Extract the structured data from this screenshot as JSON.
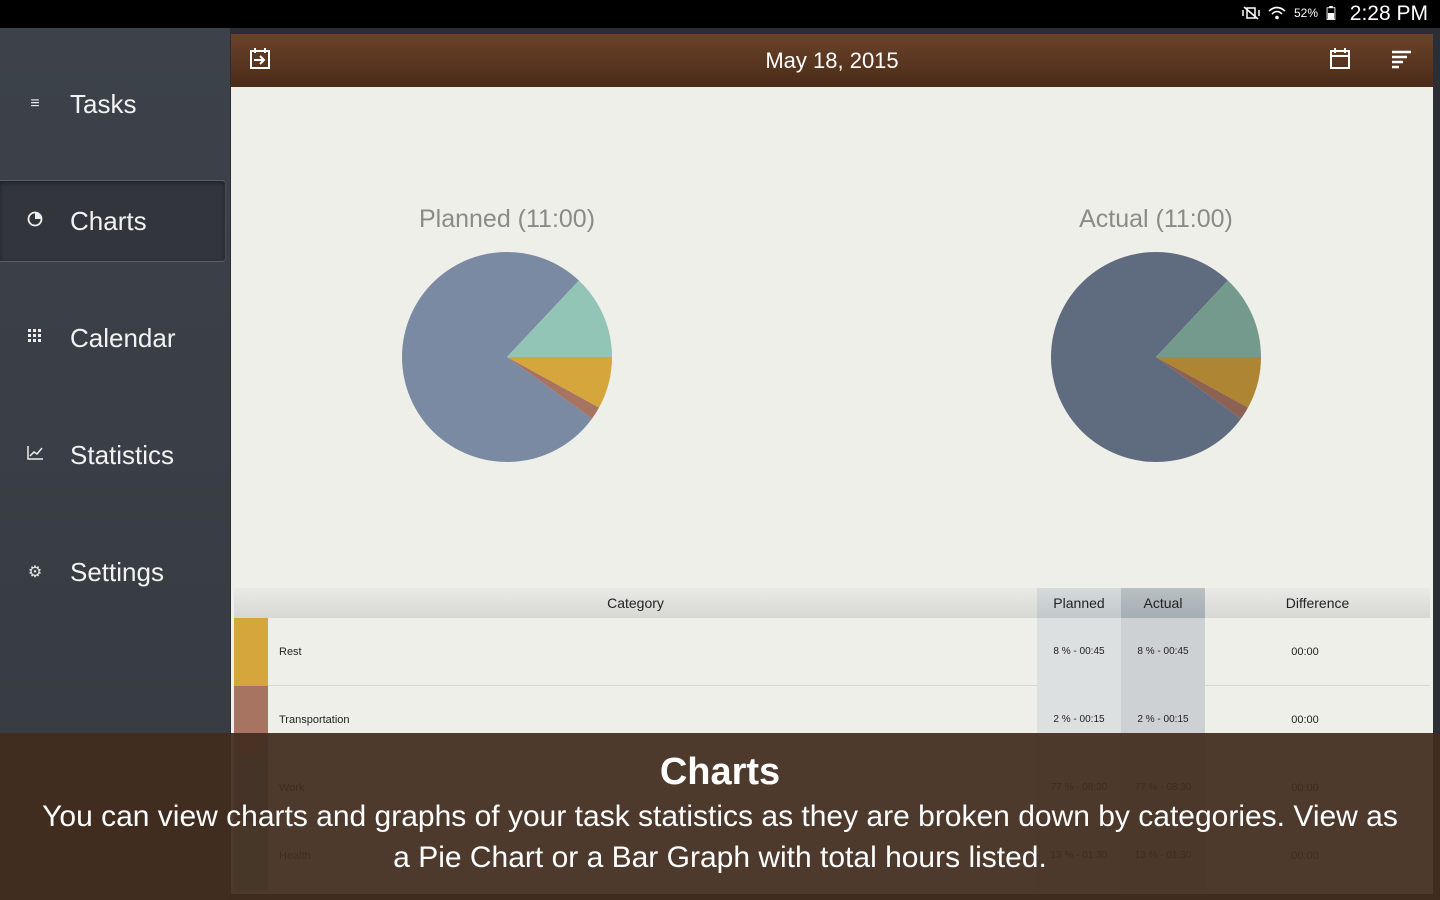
{
  "status_bar": {
    "battery": "52%",
    "clock": "2:28 PM",
    "icons": [
      "mute-vibrate-icon",
      "wifi-icon",
      "battery-icon"
    ]
  },
  "sidebar": {
    "items": [
      {
        "label": "Tasks",
        "icon": "menu-icon"
      },
      {
        "label": "Charts",
        "icon": "pie-chart-icon",
        "active": true
      },
      {
        "label": "Calendar",
        "icon": "grid-icon"
      },
      {
        "label": "Statistics",
        "icon": "line-chart-icon"
      },
      {
        "label": "Settings",
        "icon": "gear-icon"
      }
    ]
  },
  "toolbar": {
    "date": "May 18, 2015",
    "left_icon": "export-calendar-icon",
    "right_icons": [
      "calendar-icon",
      "sort-list-icon"
    ]
  },
  "charts": {
    "planned_title": "Planned (11:00)",
    "actual_title": "Actual (11:00)"
  },
  "chart_data": [
    {
      "type": "pie",
      "title": "Planned (11:00)",
      "categories": [
        "Rest",
        "Transportation",
        "Work",
        "Health"
      ],
      "values": [
        8,
        2,
        77,
        13
      ],
      "colors": [
        "#d5a63c",
        "#a87462",
        "#7a8aa3",
        "#93c5b6"
      ]
    },
    {
      "type": "pie",
      "title": "Actual (11:00)",
      "categories": [
        "Rest",
        "Transportation",
        "Work",
        "Health"
      ],
      "values": [
        8,
        2,
        77,
        13
      ],
      "colors": [
        "#ad8533",
        "#8d6254",
        "#5f6b7e",
        "#739a8c"
      ]
    }
  ],
  "table": {
    "headers": {
      "category": "Category",
      "planned": "Planned",
      "actual": "Actual",
      "difference": "Difference"
    },
    "rows": [
      {
        "name": "Rest",
        "planned": "8 % - 00:45",
        "actual": "8 % - 00:45",
        "difference": "00:00",
        "color": "#d5a63c"
      },
      {
        "name": "Transportation",
        "planned": "2 % - 00:15",
        "actual": "2 % - 00:15",
        "difference": "00:00",
        "color": "#a87462"
      },
      {
        "name": "Work",
        "planned": "77 % - 08:30",
        "actual": "77 % - 08:30",
        "difference": "00:00",
        "color": "#7a8aa3"
      },
      {
        "name": "Health",
        "planned": "13 % - 01:30",
        "actual": "13 % - 01:30",
        "difference": "00:00",
        "color": "#93c5b6"
      }
    ]
  },
  "overlay": {
    "title": "Charts",
    "text": "You can view charts and graphs of your task statistics as they are broken down by categories. View as a Pie Chart or a Bar Graph with total hours listed."
  }
}
